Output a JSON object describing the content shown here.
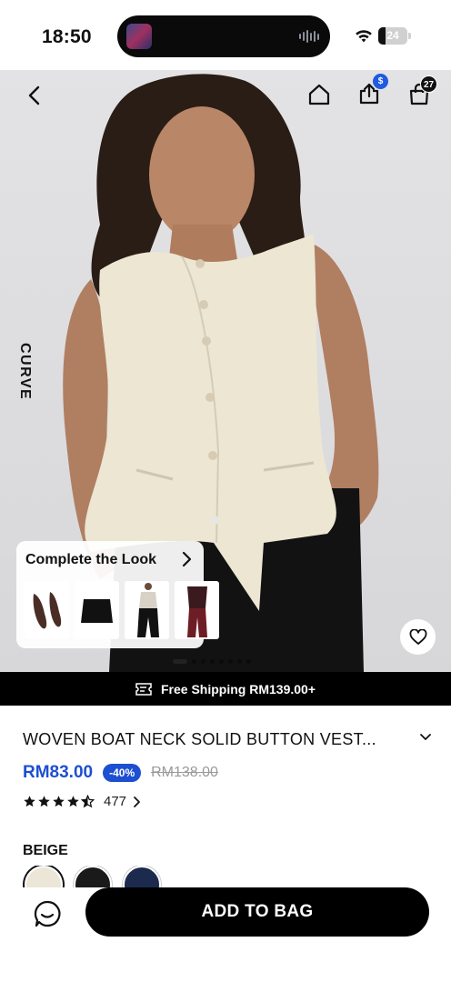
{
  "status_bar": {
    "time": "18:50",
    "battery": "24",
    "battery_level": 0.24
  },
  "hero": {
    "side_label": "CURVE",
    "share_badge": "$",
    "bag_count": "27",
    "complete_look": {
      "title": "Complete the Look",
      "items": [
        "flats",
        "skirt",
        "trousers",
        "burgundy-pants"
      ]
    },
    "carousel": {
      "count": 8,
      "active_index": 0
    }
  },
  "shipping_banner": {
    "text": "Free Shipping RM139.00+"
  },
  "product": {
    "title": "WOVEN BOAT NECK SOLID BUTTON VEST...",
    "price": "RM83.00",
    "discount": "-40%",
    "original_price": "RM138.00",
    "rating": 4.5,
    "review_count": "477",
    "color_label": "BEIGE",
    "swatch_colors": [
      "#ece6d8",
      "#1a1a1a",
      "#1c2a4e"
    ]
  },
  "bottom_bar": {
    "add_to_bag_label": "ADD TO BAG"
  },
  "colors": {
    "accent_blue": "#1d4fd1",
    "black": "#000000"
  }
}
